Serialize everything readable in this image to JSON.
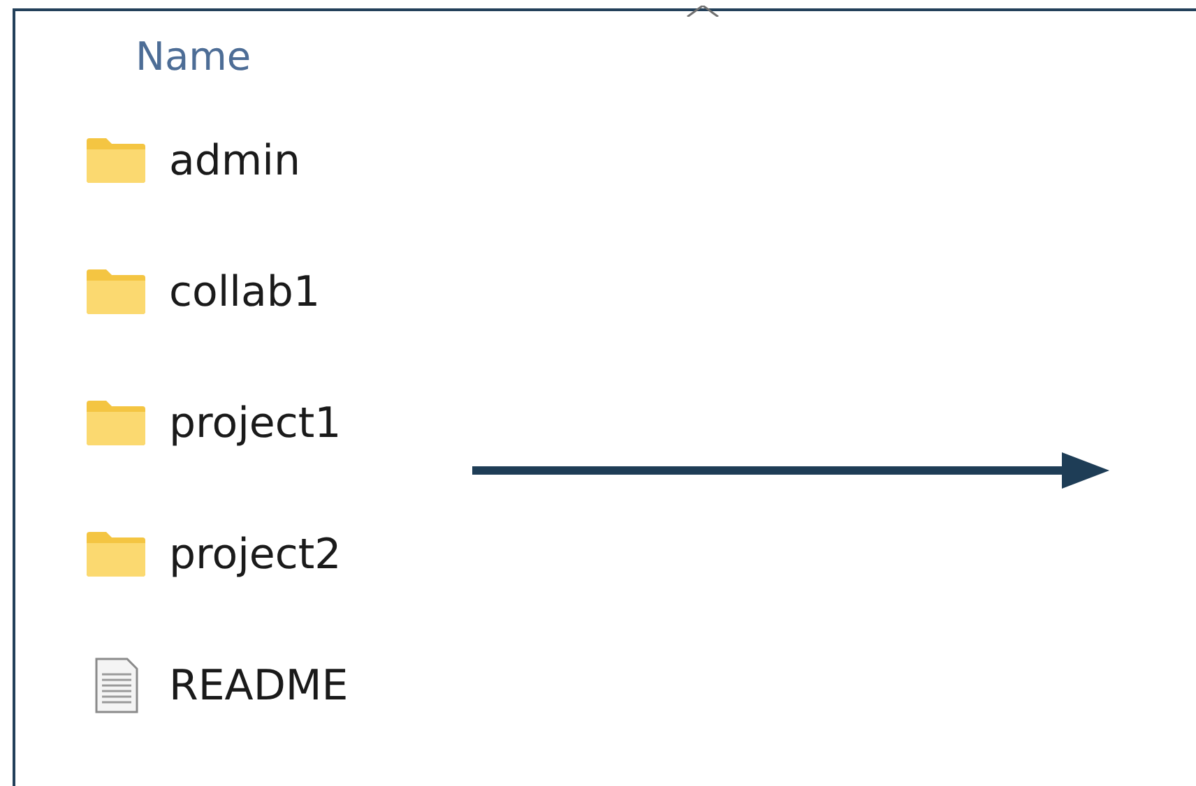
{
  "column_header": {
    "label": "Name"
  },
  "items": [
    {
      "name": "admin",
      "kind": "folder"
    },
    {
      "name": "collab1",
      "kind": "folder"
    },
    {
      "name": "project1",
      "kind": "folder"
    },
    {
      "name": "project2",
      "kind": "folder"
    },
    {
      "name": "README",
      "kind": "file"
    }
  ]
}
